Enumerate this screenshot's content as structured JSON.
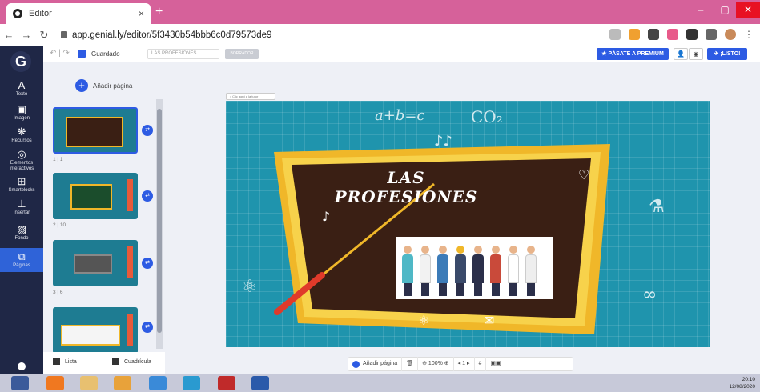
{
  "browser": {
    "tab_title": "Editor",
    "tab_close": "×",
    "new_tab": "+",
    "url": "app.genial.ly/editor/5f3430b54bbb6c0d79573de9",
    "controls": {
      "minimize": "–",
      "maximize": "▢",
      "close": "✕"
    }
  },
  "sidebar": {
    "logo": "G",
    "items": [
      {
        "label": "Texto",
        "icon": "A"
      },
      {
        "label": "Imagen",
        "icon": "▣"
      },
      {
        "label": "Recursos",
        "icon": "❋"
      },
      {
        "label": "Elementos interactivos",
        "icon": "◎"
      },
      {
        "label": "Smartblocks",
        "icon": "⊞"
      },
      {
        "label": "Insertar",
        "icon": "⊥"
      },
      {
        "label": "Fondo",
        "icon": "▨"
      },
      {
        "label": "Páginas",
        "icon": "⧉"
      }
    ]
  },
  "toolbar": {
    "saved": "Guardado",
    "title_value": "LAS PROFESIONES",
    "draft": "BORRADOR",
    "premium": "PÁSATE A PREMIUM",
    "listo": "¡LISTO!"
  },
  "pages_panel": {
    "add_page": "Añadir página",
    "pages": [
      {
        "label": "1 | 1"
      },
      {
        "label": "2 | 10"
      },
      {
        "label": "3 | 6"
      },
      {
        "label": ""
      }
    ],
    "view_list": "Lista",
    "view_grid": "Cuadrícula"
  },
  "slide": {
    "title": "LAS PROFESIONES",
    "top_button": "Clic aquí a la tutor"
  },
  "bottombar": {
    "add_page": "Añadir página",
    "zoom": "100%",
    "page": "1"
  },
  "taskbar": {
    "time": "20:10",
    "date": "12/08/2020"
  }
}
